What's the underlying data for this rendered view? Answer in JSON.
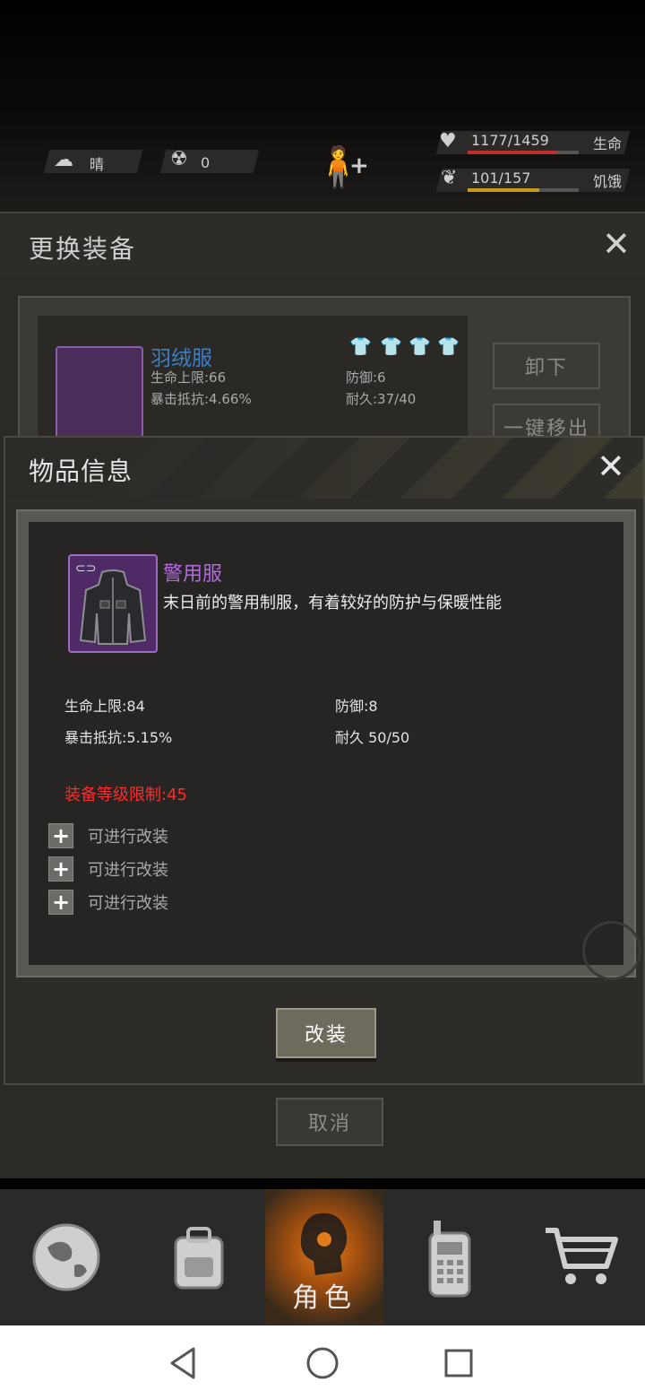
{
  "hud": {
    "weather": "晴",
    "radiation": "0",
    "health_value": "1177/1459",
    "health_label": "生命",
    "health_fraction": 0.807,
    "hunger_value": "101/157",
    "hunger_label": "饥饿",
    "hunger_fraction": 0.643
  },
  "equip_dialog": {
    "title": "更换装备",
    "current_item": {
      "name": "羽绒服",
      "stat1": "生命上限:66",
      "stat2": "暴击抵抗:4.66%",
      "stat3": "防御:6",
      "stat4": "耐久:37/40"
    },
    "unequip_label": "卸下",
    "auto_remove_label": "一键移出",
    "cancel_label": "取消"
  },
  "item_info": {
    "title": "物品信息",
    "item_name": "警用服",
    "description": "末日前的警用制服，有着较好的防护与保暖性能",
    "stats": {
      "hp_max": "生命上限:84",
      "defense": "防御:8",
      "crit_resist": "暴击抵抗:5.15%",
      "durability": "耐久 50/50"
    },
    "level_limit": "装备等级限制:45",
    "mods": [
      "可进行改装",
      "可进行改装",
      "可进行改装"
    ],
    "modify_label": "改装"
  },
  "nav": {
    "items": [
      "world-icon",
      "backpack-icon",
      "character-icon",
      "radio-icon",
      "cart-icon"
    ],
    "active_label": "角色"
  },
  "colors": {
    "item_name_purple": "#b469e0",
    "equip_item_blue": "#3d7fc6",
    "warning_red": "#ff2a2a",
    "active_tab_orange": "#e07a1a"
  }
}
